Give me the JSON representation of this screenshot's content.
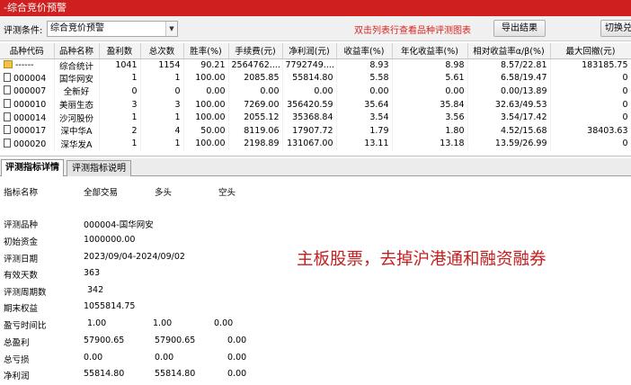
{
  "window": {
    "title": "-综合竞价预警"
  },
  "toolbar": {
    "label": "评测条件:",
    "condition_value": "综合竞价预警",
    "hint": "双击列表行查看品种评测图表",
    "export_label": "导出结果",
    "switch_label": "切换兑"
  },
  "grid": {
    "headers": [
      "品种代码",
      "品种名称",
      "盈利数",
      "总次数",
      "胜率(%)",
      "手续费(元)",
      "净利润(元)",
      "收益率(%)",
      "年化收益率(%)",
      "相对收益率α/β(%)",
      "最大回撤(元)"
    ],
    "rows": [
      {
        "icon": "folder-icon",
        "cells": [
          "------",
          "综合统计",
          "1041",
          "1154",
          "90.21",
          "2564762....",
          "7792749....",
          "8.93",
          "8.98",
          "8.57/22.81",
          "183185.75"
        ]
      },
      {
        "icon": "document-icon",
        "cells": [
          "000004",
          "国华网安",
          "1",
          "1",
          "100.00",
          "2085.85",
          "55814.80",
          "5.58",
          "5.61",
          "6.58/19.47",
          "0"
        ]
      },
      {
        "icon": "document-icon",
        "cells": [
          "000007",
          "全新好",
          "0",
          "0",
          "0.00",
          "0.00",
          "0.00",
          "0.00",
          "0.00",
          "0.00/13.89",
          "0"
        ]
      },
      {
        "icon": "document-icon",
        "cells": [
          "000010",
          "美丽生态",
          "3",
          "3",
          "100.00",
          "7269.00",
          "356420.59",
          "35.64",
          "35.84",
          "32.63/49.53",
          "0"
        ]
      },
      {
        "icon": "document-icon",
        "cells": [
          "000014",
          "沙河股份",
          "1",
          "1",
          "100.00",
          "2055.12",
          "35368.84",
          "3.54",
          "3.56",
          "3.54/17.42",
          "0"
        ]
      },
      {
        "icon": "document-icon",
        "cells": [
          "000017",
          "深中华A",
          "2",
          "4",
          "50.00",
          "8119.06",
          "17907.72",
          "1.79",
          "1.80",
          "4.52/15.68",
          "38403.63"
        ]
      },
      {
        "icon": "document-icon",
        "cells": [
          "000020",
          "深华发A",
          "1",
          "1",
          "100.00",
          "2198.89",
          "131067.00",
          "13.11",
          "13.18",
          "13.59/26.99",
          "0"
        ]
      }
    ]
  },
  "tabs": [
    {
      "label": "评测指标详情",
      "active": true
    },
    {
      "label": "评测指标说明",
      "active": false
    }
  ],
  "detail": {
    "header": {
      "name": "指标名称",
      "all": "全部交易",
      "long": "多头",
      "short": "空头"
    },
    "info": [
      {
        "label": "评测品种",
        "value": "000004-国华网安"
      },
      {
        "label": "初始资金",
        "value": "1000000.00"
      },
      {
        "label": "评测日期",
        "value": "2023/09/04-2024/09/02"
      },
      {
        "label": "有效天数",
        "value": "363"
      },
      {
        "label": "评测周期数",
        "value": "342"
      },
      {
        "label": "期末权益",
        "value": "1055814.75"
      }
    ],
    "metrics": [
      {
        "label": "盈亏时间比",
        "all": "1.00",
        "long": "1.00",
        "short": "0.00"
      },
      {
        "label": "总盈利",
        "all": "57900.65",
        "long": "57900.65",
        "short": "0.00"
      },
      {
        "label": "总亏损",
        "all": "0.00",
        "long": "0.00",
        "short": "0.00"
      },
      {
        "label": "净利润",
        "all": "55814.80",
        "long": "55814.80",
        "short": "0.00"
      }
    ]
  },
  "overlay": {
    "text": "主板股票，去掉沪港通和融资融券"
  }
}
